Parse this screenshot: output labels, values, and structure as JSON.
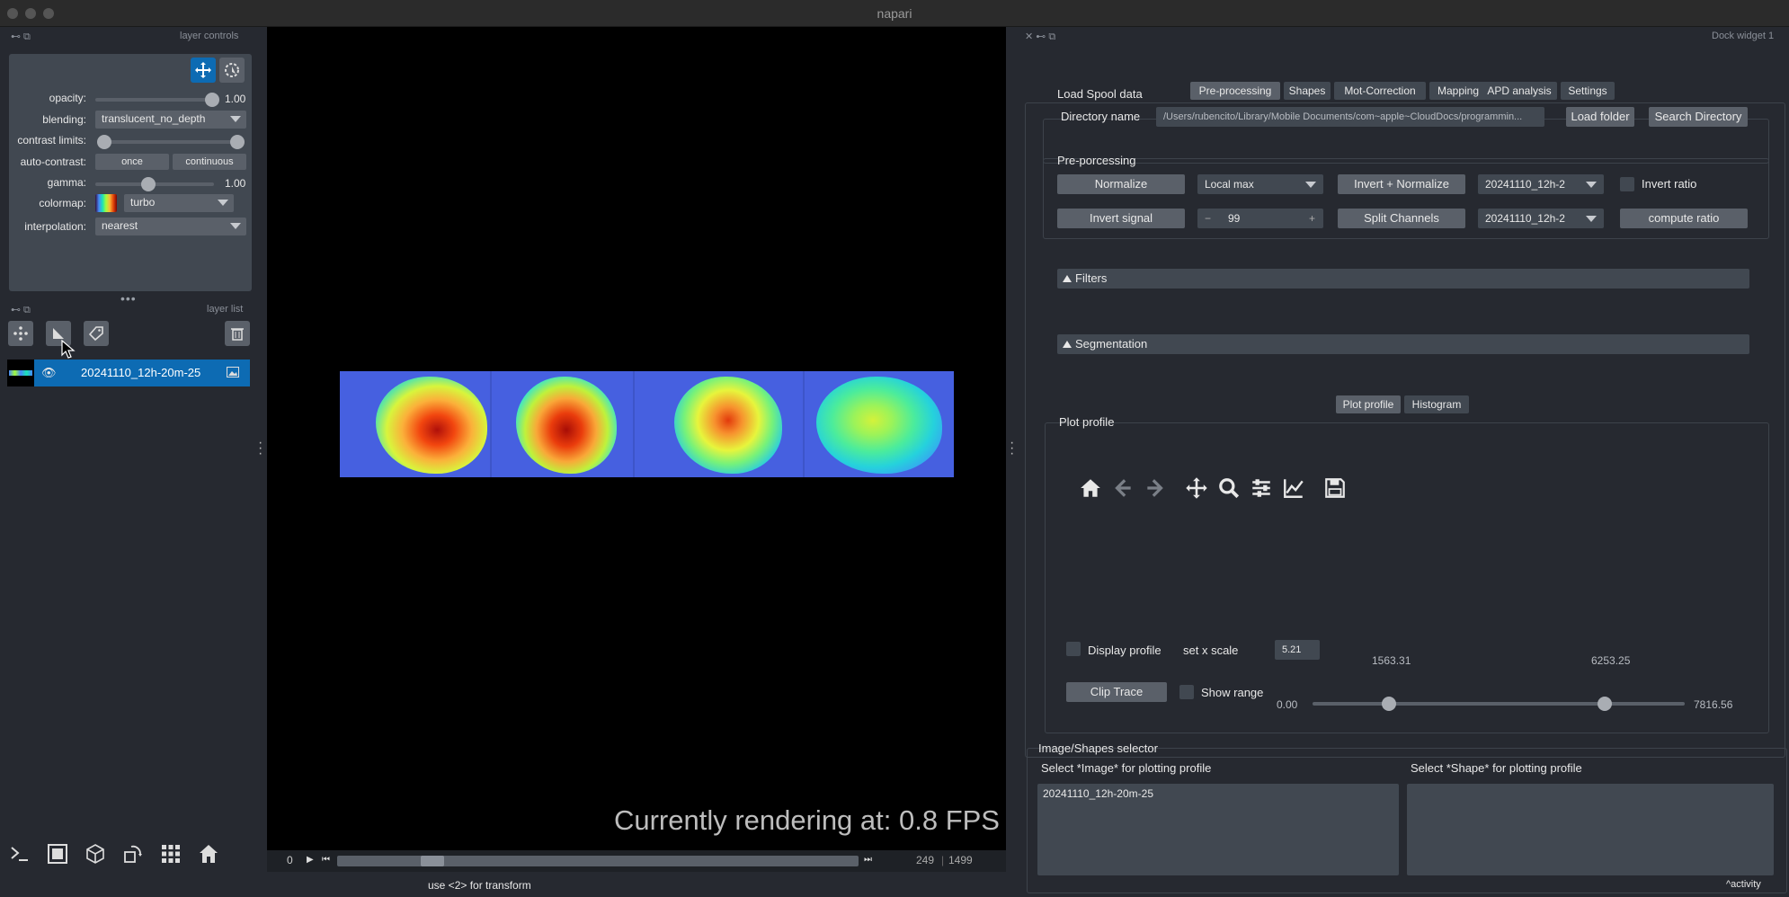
{
  "window": {
    "title": "napari"
  },
  "layer_controls": {
    "header": "layer controls",
    "opacity": {
      "label": "opacity:",
      "value": "1.00",
      "level": 1.0
    },
    "blending": {
      "label": "blending:",
      "value": "translucent_no_depth"
    },
    "contrast_limits": {
      "label": "contrast limits:",
      "range": [
        0.0,
        1.0
      ]
    },
    "auto_contrast": {
      "label": "auto-contrast:",
      "once": "once",
      "continuous": "continuous"
    },
    "gamma": {
      "label": "gamma:",
      "value": "1.00",
      "level": 0.5
    },
    "colormap": {
      "label": "colormap:",
      "value": "turbo"
    },
    "interpolation": {
      "label": "interpolation:",
      "value": "nearest"
    }
  },
  "layer_list": {
    "header": "layer list",
    "layers": [
      {
        "name": "20241110_12h-20m-25",
        "visible": true,
        "type": "image"
      }
    ]
  },
  "canvas": {
    "fps_text": "Currently rendering at: 0.8 FPS",
    "dims": {
      "start": "0",
      "current": "249",
      "total": "1499"
    }
  },
  "status_bar": {
    "hint": "use <2> for transform",
    "activity": "activity"
  },
  "dock": {
    "title": "Dock widget 1",
    "tabs": [
      "Pre-processing",
      "Shapes",
      "Mot-Correction",
      "Mapping",
      "APD analysis",
      "Settings"
    ],
    "active_tab": "Pre-processing",
    "load_spool": {
      "title": "Load Spool data",
      "directory_label": "Directory name",
      "directory_value": "/Users/rubencito/Library/Mobile Documents/com~apple~CloudDocs/programmin...",
      "load_folder": "Load folder",
      "search_directory": "Search Directory"
    },
    "preprocessing": {
      "title": "Pre-porcessing",
      "normalize": "Normalize",
      "local_max": "Local max",
      "invert_normalize": "Invert + Normalize",
      "select_a": "20241110_12h-2",
      "invert_ratio": "Invert ratio",
      "invert_signal": "Invert signal",
      "spin_minus": "−",
      "spin_value": "99",
      "spin_plus": "+",
      "split_channels": "Split Channels",
      "select_b": "20241110_12h-2",
      "compute_ratio": "compute ratio"
    },
    "filters": "Filters",
    "segmentation": "Segmentation",
    "plot_tabs": [
      "Plot profile",
      "Histogram"
    ],
    "plot_profile": {
      "title": "Plot profile",
      "display_profile": "Display profile",
      "set_x_scale": "set x scale",
      "x_scale_value": "5.21",
      "clip_trace": "Clip Trace",
      "show_range": "Show range",
      "range_min": "0.00",
      "range_max": "7816.56",
      "low": "1563.31",
      "high": "6253.25"
    },
    "selector": {
      "title": "Image/Shapes selector",
      "image_label": "Select *Image* for plotting profile",
      "shape_label": "Select *Shape* for plotting profile",
      "image_items": [
        "20241110_12h-20m-25"
      ]
    }
  }
}
